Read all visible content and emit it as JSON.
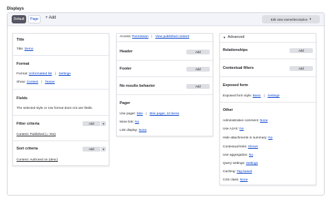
{
  "displays": {
    "title": "Displays",
    "tabs": [
      {
        "label": "Default"
      },
      {
        "label": "Page"
      }
    ],
    "add_label": "+ Add",
    "edit_label": "Edit view name/description"
  },
  "column1": {
    "title": {
      "heading": "Title",
      "prefix": "Title:",
      "value": "Demo"
    },
    "format": {
      "heading": "Format",
      "format_prefix": "Format:",
      "format_value": "Unformatted list",
      "format_settings": "Settings",
      "show_prefix": "Show:",
      "show_value": "Content",
      "show_teaser": "Teaser"
    },
    "fields": {
      "heading": "Fields",
      "note": "The selected style or row format does not use fields."
    },
    "filter": {
      "heading": "Filter criteria",
      "add": "Add",
      "item": "Content: Published (= Yes)"
    },
    "sort": {
      "heading": "Sort criteria",
      "add": "Add",
      "item": "Content: Authored on (desc)"
    }
  },
  "column2": {
    "access": {
      "prefix": "Access:",
      "value": "Permission",
      "link": "View published content"
    },
    "header": {
      "heading": "Header",
      "add": "Add"
    },
    "footer": {
      "heading": "Footer",
      "add": "Add"
    },
    "no_results": {
      "heading": "No results behavior",
      "add": "Add"
    },
    "pager": {
      "heading": "Pager",
      "use_prefix": "Use pager:",
      "use_value": "Mini",
      "use_link": "Mini pager, 10 items",
      "more_prefix": "More link:",
      "more_value": "No",
      "display_prefix": "Link display:",
      "display_value": "None"
    }
  },
  "column3": {
    "advanced_label": "Advanced",
    "relationships": {
      "heading": "Relationships",
      "add": "Add"
    },
    "contextual": {
      "heading": "Contextual filters",
      "add": "Add"
    },
    "exposed": {
      "heading": "Exposed form",
      "prefix": "Exposed form style:",
      "value": "Basic",
      "settings": "Settings"
    },
    "other": {
      "heading": "Other",
      "rows": [
        {
          "label": "Administrative comment:",
          "value": "None"
        },
        {
          "label": "Use AJAX:",
          "value": "No"
        },
        {
          "label": "Hide attachments in summary:",
          "value": "No"
        },
        {
          "label": "Contextual links:",
          "value": "Shown"
        },
        {
          "label": "Use aggregation:",
          "value": "No"
        },
        {
          "label": "Query settings:",
          "value": "Settings"
        },
        {
          "label": "Caching:",
          "value": "Tag based"
        },
        {
          "label": "CSS class:",
          "value": "None"
        }
      ]
    }
  }
}
